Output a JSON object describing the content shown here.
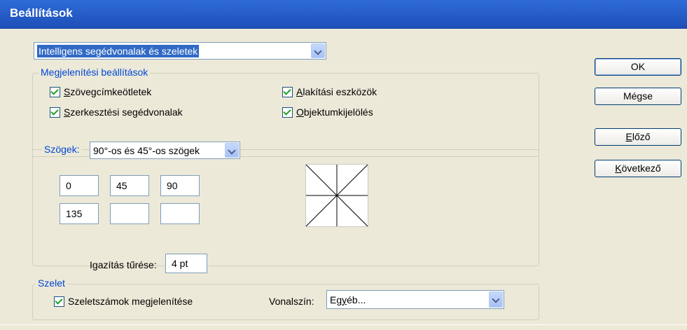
{
  "window": {
    "title": "Beállítások"
  },
  "category": {
    "selected": "Intelligens segédvonalak és szeletek"
  },
  "display_options": {
    "legend": "Megjelenítési beállítások",
    "text_label_hints": {
      "prefix": "S",
      "rest": "zövegcímkeötletek",
      "checked": true
    },
    "construction_guides": {
      "prefix": "S",
      "rest": "zerkesztési segédvonalak",
      "checked": true
    },
    "transform_tools": {
      "prefix": "A",
      "rest": "lakítási eszközök",
      "checked": true
    },
    "object_highlighting": {
      "prefix": "O",
      "rest": "bjektumkijelölés",
      "checked": true
    }
  },
  "angles": {
    "legend": "Szögek:",
    "preset": "90°-os és 45°-os szögek",
    "values": [
      "0",
      "45",
      "90",
      "135",
      "",
      ""
    ]
  },
  "snapping": {
    "label_pre": "I",
    "label_u": "g",
    "label_post": "azítás tűrése:",
    "value": "4 pt"
  },
  "slices": {
    "legend": "Szelet",
    "show_numbers": {
      "label": "Szeletszámok megjelenítése",
      "checked": true
    },
    "line_color": {
      "label": "Vonalszín:",
      "value_pre": "Eg",
      "value_u": "y",
      "value_post": "éb..."
    }
  },
  "buttons": {
    "ok": "OK",
    "cancel": "Mégse",
    "previous": {
      "pre": "",
      "u": "E",
      "post": "lőző"
    },
    "next": {
      "pre": "",
      "u": "K",
      "post": "övetkező"
    }
  },
  "icons": {
    "dropdown": "chevron-down-icon",
    "checkbox": "checkmark-icon"
  }
}
